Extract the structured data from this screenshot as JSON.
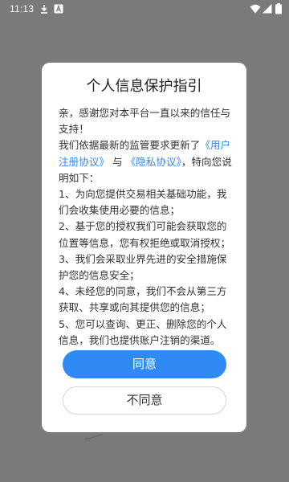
{
  "status_bar": {
    "time": "11:13"
  },
  "dialog": {
    "title": "个人信息保护指引",
    "greeting": "亲，感谢您对本平台一直以来的信任与支持！",
    "intro_prefix": "我们依据最新的监管要求更新了",
    "user_agreement_link": "《用户注册协议》",
    "conjunction": "与",
    "privacy_link": "《隐私协议》",
    "intro_suffix": "，特向您说明如下：",
    "points": [
      "1、为向您提供交易相关基础功能，我们会收集使用必要的信息；",
      "2、基于您的授权我们可能会获取您的位置等信息，您有权拒绝或取消授权；",
      "3、我们会采取业界先进的安全措施保护您的信息安全；",
      "4、未经您的同意，我们不会从第三方获取、共享或向其提供您的信息；",
      "5、您可以查询、更正、删除您的个人信息，我们也提供账户注销的渠道。"
    ],
    "agree_label": "同意",
    "disagree_label": "不同意"
  },
  "colors": {
    "backdrop": "#7a7a7a",
    "accent": "#2f8af5",
    "link": "#3a86e8"
  }
}
